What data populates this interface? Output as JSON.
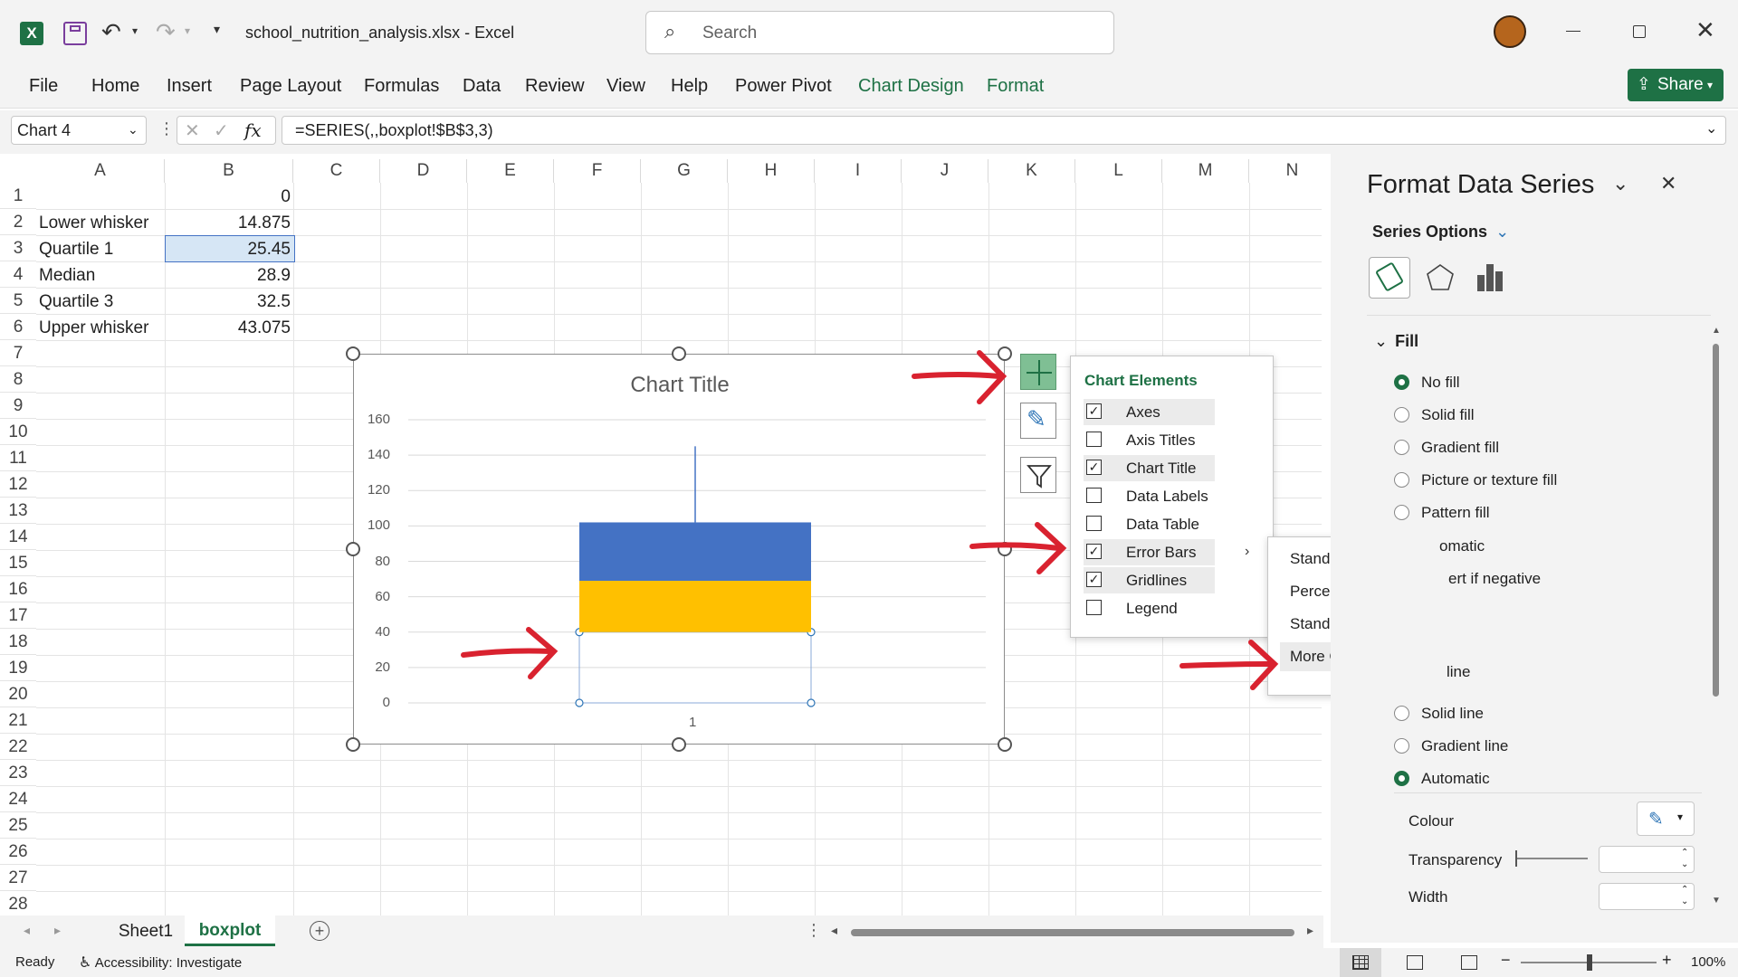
{
  "app": {
    "file_name": "school_nutrition_analysis.xlsx",
    "separator": "-",
    "app_name": "Excel"
  },
  "search": {
    "placeholder": "Search"
  },
  "ribbon_tabs": [
    "File",
    "Home",
    "Insert",
    "Page Layout",
    "Formulas",
    "Data",
    "Review",
    "View",
    "Help",
    "Power Pivot",
    "Chart Design",
    "Format"
  ],
  "share_label": "Share",
  "name_box": "Chart 4",
  "fx": "fx",
  "formula": "=SERIES(,,boxplot!$B$3,3)",
  "columns": [
    "A",
    "B",
    "C",
    "D",
    "E",
    "F",
    "G",
    "H",
    "I",
    "J",
    "K",
    "L",
    "M",
    "N"
  ],
  "rows": [
    "1",
    "2",
    "3",
    "4",
    "5",
    "6",
    "7",
    "8",
    "9",
    "10",
    "11",
    "12",
    "13",
    "14",
    "15",
    "16",
    "17",
    "18",
    "19",
    "20",
    "21",
    "22",
    "23",
    "24",
    "25",
    "26",
    "27",
    "28"
  ],
  "cells": {
    "b1": "0",
    "a2": "Lower whisker",
    "b2": "14.875",
    "a3": "Quartile 1",
    "b3": "25.45",
    "a4": "Median",
    "b4": "28.9",
    "a5": "Quartile 3",
    "b5": "32.5",
    "a6": "Upper whisker",
    "b6": "43.075"
  },
  "chart": {
    "title": "Chart Title",
    "y_ticks": [
      "160",
      "140",
      "120",
      "100",
      "80",
      "60",
      "40",
      "20",
      "0"
    ],
    "x_label": "1"
  },
  "chart_data": {
    "type": "bar",
    "stacked": true,
    "categories": [
      "1"
    ],
    "series": [
      {
        "values": [
          40
        ],
        "color": "none"
      },
      {
        "values": [
          29
        ],
        "color": "#ffc000"
      },
      {
        "values": [
          33
        ],
        "color": "#4472c4"
      }
    ],
    "error_bar_top": 145,
    "ylim": [
      0,
      160
    ],
    "y_ticks": [
      0,
      20,
      40,
      60,
      80,
      100,
      120,
      140,
      160
    ],
    "grid": true
  },
  "chart_elements": {
    "title": "Chart Elements",
    "items": [
      {
        "label": "Axes",
        "checked": true
      },
      {
        "label": "Axis Titles",
        "checked": false
      },
      {
        "label": "Chart Title",
        "checked": true
      },
      {
        "label": "Data Labels",
        "checked": false
      },
      {
        "label": "Data Table",
        "checked": false
      },
      {
        "label": "Error Bars",
        "checked": true
      },
      {
        "label": "Gridlines",
        "checked": true
      },
      {
        "label": "Legend",
        "checked": false
      }
    ],
    "check_mark": "✓"
  },
  "error_bar_menu": [
    "Standard Error",
    "Percentage",
    "Standard Deviation",
    "More Options..."
  ],
  "panel": {
    "title": "Format Data Series",
    "series_options": "Series Options",
    "fill_header": "Fill",
    "fill_options": [
      {
        "label": "No fill",
        "on": true
      },
      {
        "label": "Solid fill",
        "on": false
      },
      {
        "label": "Gradient fill",
        "on": false
      },
      {
        "label": "Picture or texture fill",
        "on": false
      },
      {
        "label": "Pattern fill",
        "on": false
      }
    ],
    "partial_automatic": "omatic",
    "partial_invert": "ert if negative",
    "partial_line": "line",
    "line_options": [
      {
        "label": "Solid line",
        "on": false
      },
      {
        "label": "Gradient line",
        "on": false
      },
      {
        "label": "Automatic",
        "on": true
      }
    ],
    "colour": "Colour",
    "transparency": "Transparency",
    "width": "Width"
  },
  "sheet_tabs": [
    "Sheet1",
    "boxplot"
  ],
  "status": {
    "ready": "Ready",
    "accessibility": "Accessibility: Investigate",
    "zoom": "100%"
  }
}
